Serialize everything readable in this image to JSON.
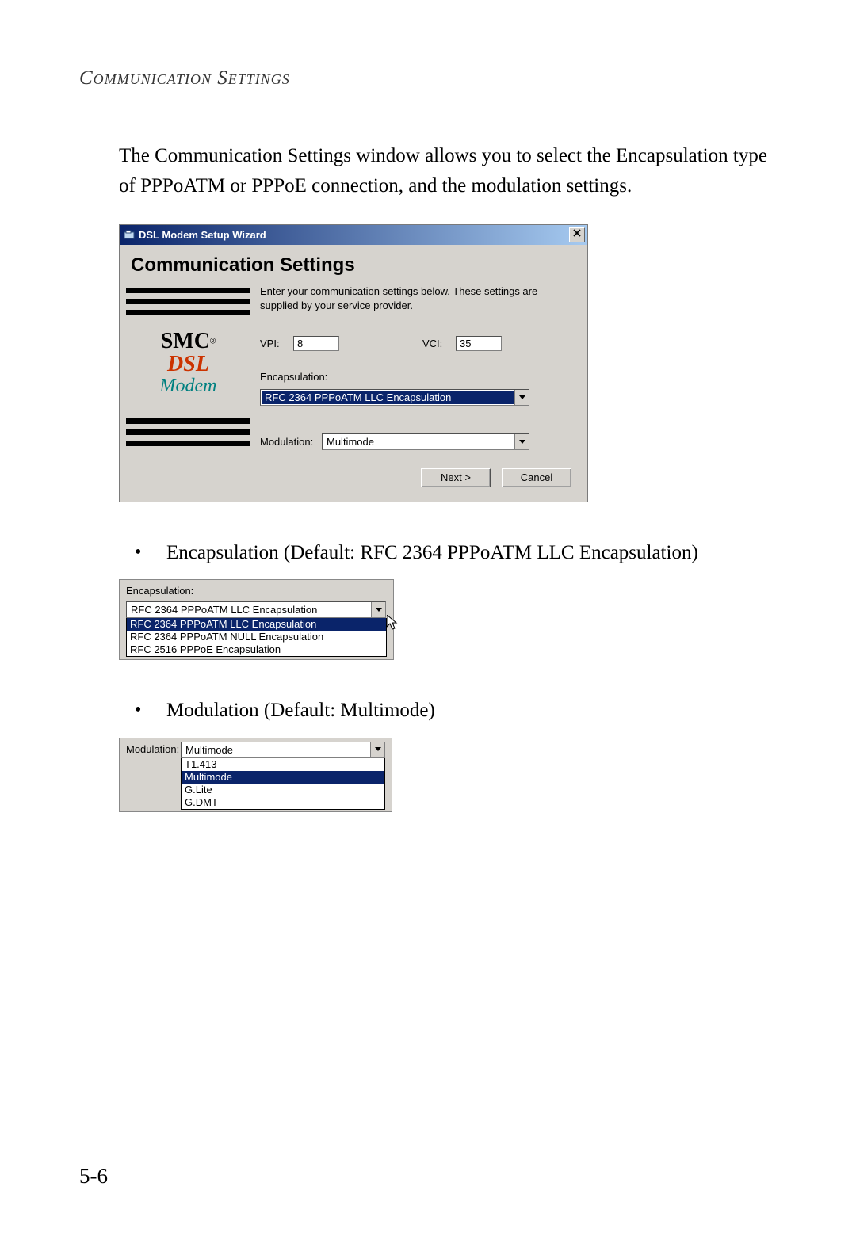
{
  "page": {
    "section_title": "Communication Settings",
    "intro": "The Communication Settings window allows you to select the Encapsulation type of PPPoATM or PPPoE connection, and the modulation settings.",
    "page_number": "5-6"
  },
  "dialog": {
    "title": "DSL Modem Setup Wizard",
    "heading": "Communication Settings",
    "instructions": "Enter your communication settings below.  These settings are supplied by your service provider.",
    "vpi_label": "VPI:",
    "vpi_value": "8",
    "vci_label": "VCI:",
    "vci_value": "35",
    "encapsulation_label": "Encapsulation:",
    "encapsulation_value": "RFC 2364 PPPoATM LLC Encapsulation",
    "modulation_label": "Modulation:",
    "modulation_value": "Multimode",
    "next_button": "Next >",
    "cancel_button": "Cancel",
    "logo": {
      "brand": "SMC",
      "reg": "®",
      "line1": "DSL",
      "line2": "Modem"
    }
  },
  "bullets": {
    "encapsulation": "Encapsulation (Default: RFC 2364 PPPoATM LLC Encapsulation)",
    "modulation": "Modulation (Default: Multimode)"
  },
  "encap_snippet": {
    "label": "Encapsulation:",
    "selected": "RFC 2364 PPPoATM LLC Encapsulation",
    "options": [
      "RFC 2364 PPPoATM LLC Encapsulation",
      "RFC 2364 PPPoATM NULL Encapsulation",
      "RFC 2516 PPPoE Encapsulation"
    ]
  },
  "mod_snippet": {
    "label": "Modulation:",
    "selected": "Multimode",
    "options": [
      "T1.413",
      "Multimode",
      "G.Lite",
      "G.DMT"
    ]
  }
}
